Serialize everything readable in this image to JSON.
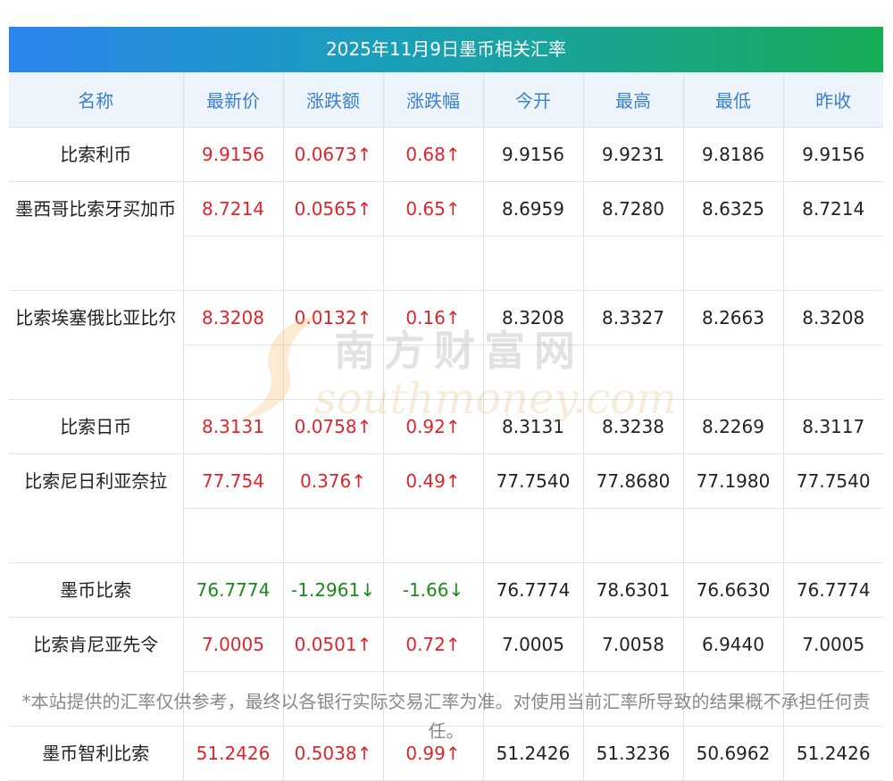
{
  "title": "2025年11月9日墨币相关汇率",
  "headers": [
    "名称",
    "最新价",
    "涨跌额",
    "涨跌幅",
    "今开",
    "最高",
    "最低",
    "昨收"
  ],
  "rows": [
    {
      "name": "比索利币",
      "latest": "9.9156",
      "change": "0.0673↑",
      "pct": "0.68↑",
      "open": "9.9156",
      "high": "9.9231",
      "low": "9.8186",
      "prev": "9.9156",
      "trend": "up"
    },
    {
      "name": "墨西哥比索牙买加币",
      "latest": "8.7214",
      "change": "0.0565↑",
      "pct": "0.65↑",
      "open": "8.6959",
      "high": "8.7280",
      "low": "8.6325",
      "prev": "8.7214",
      "trend": "up"
    },
    {
      "name": "比索埃塞俄比亚比尔",
      "latest": "8.3208",
      "change": "0.0132↑",
      "pct": "0.16↑",
      "open": "8.3208",
      "high": "8.3327",
      "low": "8.2663",
      "prev": "8.3208",
      "trend": "up"
    },
    {
      "name": "比索日币",
      "latest": "8.3131",
      "change": "0.0758↑",
      "pct": "0.92↑",
      "open": "8.3131",
      "high": "8.3238",
      "low": "8.2269",
      "prev": "8.3117",
      "trend": "up"
    },
    {
      "name": "比索尼日利亚奈拉",
      "latest": "77.754",
      "change": "0.376↑",
      "pct": "0.49↑",
      "open": "77.7540",
      "high": "77.8680",
      "low": "77.1980",
      "prev": "77.7540",
      "trend": "up"
    },
    {
      "name": "墨币比索",
      "latest": "76.7774",
      "change": "-1.2961↓",
      "pct": "-1.66↓",
      "open": "76.7774",
      "high": "78.6301",
      "low": "76.6630",
      "prev": "76.7774",
      "trend": "down"
    },
    {
      "name": "比索肯尼亚先令",
      "latest": "7.0005",
      "change": "0.0501↑",
      "pct": "0.72↑",
      "open": "7.0005",
      "high": "7.0058",
      "low": "6.9440",
      "prev": "7.0005",
      "trend": "up"
    },
    {
      "name": "墨币智利比索",
      "latest": "51.2426",
      "change": "0.5038↑",
      "pct": "0.99↑",
      "open": "51.2426",
      "high": "51.3236",
      "low": "50.6962",
      "prev": "51.2426",
      "trend": "up"
    }
  ],
  "watermark": {
    "cn": "南方财富网",
    "en": "southmoney.com"
  },
  "footnote": "*本站提供的汇率仅供参考，最终以各银行实际交易汇率为准。对使用当前汇率所导致的结果概不承担任何责任。",
  "colors": {
    "up": "#e0242b",
    "down": "#1a8a1a",
    "header_text": "#3a7fd0",
    "header_bg": "#edf4fb",
    "title_gradient_start": "#2a86ee",
    "title_gradient_end": "#16ad58"
  }
}
